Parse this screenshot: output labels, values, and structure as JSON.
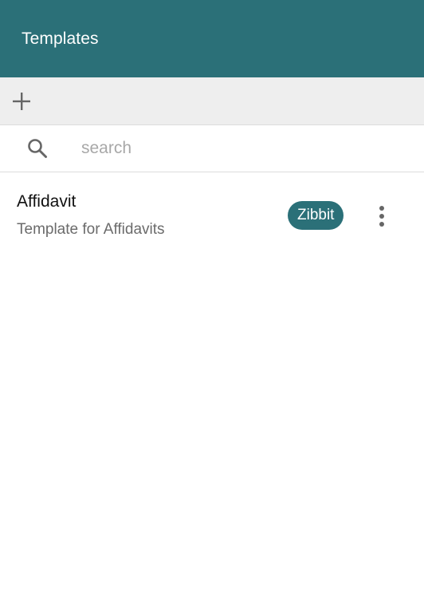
{
  "header": {
    "title": "Templates"
  },
  "toolbar": {
    "add_icon": "plus-icon"
  },
  "search": {
    "icon": "search-icon",
    "placeholder": "search",
    "value": ""
  },
  "templates": [
    {
      "title": "Affidavit",
      "description": "Template for Affidavits",
      "tag": "Zibbit",
      "menu_icon": "more-vertical-icon"
    }
  ],
  "colors": {
    "primary": "#2b7078",
    "toolbar_bg": "#eeeeee",
    "icon": "#666666"
  }
}
